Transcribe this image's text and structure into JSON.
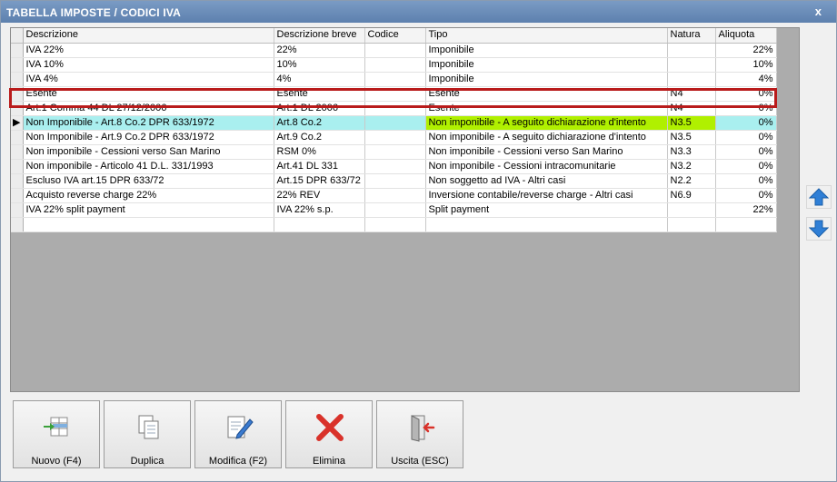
{
  "window": {
    "title": "TABELLA IMPOSTE / CODICI IVA",
    "close_label": "x"
  },
  "grid": {
    "columns": [
      "Descrizione",
      "Descrizione breve",
      "Codice",
      "Tipo",
      "Natura",
      "Aliquota"
    ],
    "rows": [
      {
        "descrizione": "IVA 22%",
        "breve": "22%",
        "codice": "",
        "tipo": "Imponibile",
        "natura": "",
        "aliquota": "22%"
      },
      {
        "descrizione": "IVA 10%",
        "breve": "10%",
        "codice": "",
        "tipo": "Imponibile",
        "natura": "",
        "aliquota": "10%"
      },
      {
        "descrizione": "IVA 4%",
        "breve": "4%",
        "codice": "",
        "tipo": "Imponibile",
        "natura": "",
        "aliquota": "4%"
      },
      {
        "descrizione": "Esente",
        "breve": "Esente",
        "codice": "",
        "tipo": "Esente",
        "natura": "N4",
        "aliquota": "0%"
      },
      {
        "descrizione": "Art.1 Comma 44 DL 27/12/2006",
        "breve": "Art.1 DL 2006",
        "codice": "",
        "tipo": "Esente",
        "natura": "N4",
        "aliquota": "0%"
      },
      {
        "descrizione": "Non Imponibile - Art.8 Co.2 DPR 633/1972",
        "breve": "Art.8 Co.2",
        "codice": "",
        "tipo": "Non imponibile - A seguito dichiarazione d'intento",
        "natura": "N3.5",
        "aliquota": "0%"
      },
      {
        "descrizione": "Non Imponibile - Art.9 Co.2 DPR 633/1972",
        "breve": "Art.9 Co.2",
        "codice": "",
        "tipo": "Non imponibile - A seguito dichiarazione d'intento",
        "natura": "N3.5",
        "aliquota": "0%"
      },
      {
        "descrizione": "Non imponibile - Cessioni verso San Marino",
        "breve": "RSM 0%",
        "codice": "",
        "tipo": "Non imponibile - Cessioni verso San Marino",
        "natura": "N3.3",
        "aliquota": "0%"
      },
      {
        "descrizione": "Non imponibile - Articolo 41 D.L. 331/1993",
        "breve": "Art.41 DL 331",
        "codice": "",
        "tipo": "Non imponibile - Cessioni intracomunitarie",
        "natura": "N3.2",
        "aliquota": "0%"
      },
      {
        "descrizione": "Escluso IVA art.15 DPR 633/72",
        "breve": "Art.15 DPR 633/72",
        "codice": "",
        "tipo": "Non soggetto ad IVA - Altri casi",
        "natura": "N2.2",
        "aliquota": "0%"
      },
      {
        "descrizione": "Acquisto reverse charge 22%",
        "breve": "22% REV",
        "codice": "",
        "tipo": "Inversione contabile/reverse charge - Altri casi",
        "natura": "N6.9",
        "aliquota": "0%"
      },
      {
        "descrizione": "IVA 22% split payment",
        "breve": "IVA 22% s.p.",
        "codice": "",
        "tipo": "Split payment",
        "natura": "",
        "aliquota": "22%"
      },
      {
        "descrizione": "",
        "breve": "",
        "codice": "",
        "tipo": "",
        "natura": "",
        "aliquota": ""
      }
    ],
    "selected_row": 5,
    "selected_indicator": "▶"
  },
  "side_buttons": [
    {
      "name": "move-up-button",
      "icon": "arrow-up-icon"
    },
    {
      "name": "move-down-button",
      "icon": "arrow-down-icon"
    }
  ],
  "buttons": [
    {
      "name": "nuovo-button",
      "label": "Nuovo (F4)",
      "icon": "new-row-icon"
    },
    {
      "name": "duplica-button",
      "label": "Duplica",
      "icon": "duplicate-icon"
    },
    {
      "name": "modifica-button",
      "label": "Modifica (F2)",
      "icon": "edit-icon"
    },
    {
      "name": "elimina-button",
      "label": "Elimina",
      "icon": "delete-icon"
    },
    {
      "name": "uscita-button",
      "label": "Uscita (ESC)",
      "icon": "exit-icon"
    }
  ],
  "colors": {
    "titlebar": "#5d80ae",
    "selected_row": "#a9efef",
    "selected_highlight": "#b0f000",
    "selection_frame": "#b91b1b",
    "arrow_blue": "#2f7fd6",
    "delete_red": "#d9322a"
  }
}
